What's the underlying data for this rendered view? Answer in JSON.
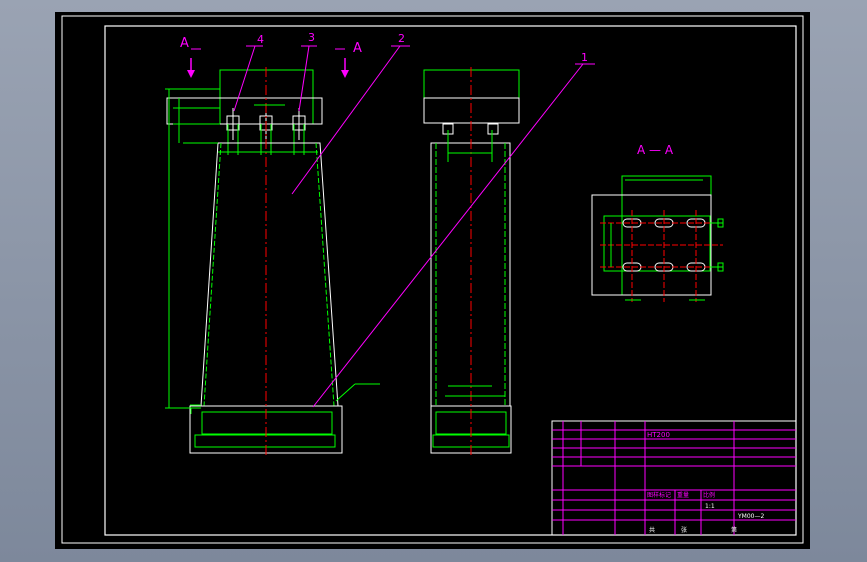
{
  "drawing": {
    "colors": {
      "background": "#000000",
      "frame": "#ffffff",
      "part": "#00ff00",
      "leader": "#ff00ff",
      "centerline": "#ff0000",
      "label": "#ff00ff"
    },
    "section_marks": {
      "left": "A",
      "right": "A"
    },
    "part_callouts": [
      "4",
      "3",
      "2",
      "1"
    ],
    "section_title": "A — A"
  },
  "title_block": {
    "name": "YM00—2",
    "scale": "1:1",
    "material": "HT200",
    "label_a": "图样标记",
    "label_b": "重量",
    "label_c": "比例",
    "sheet_left": "共",
    "sheet_mid": "张",
    "sheet_right": "第"
  }
}
